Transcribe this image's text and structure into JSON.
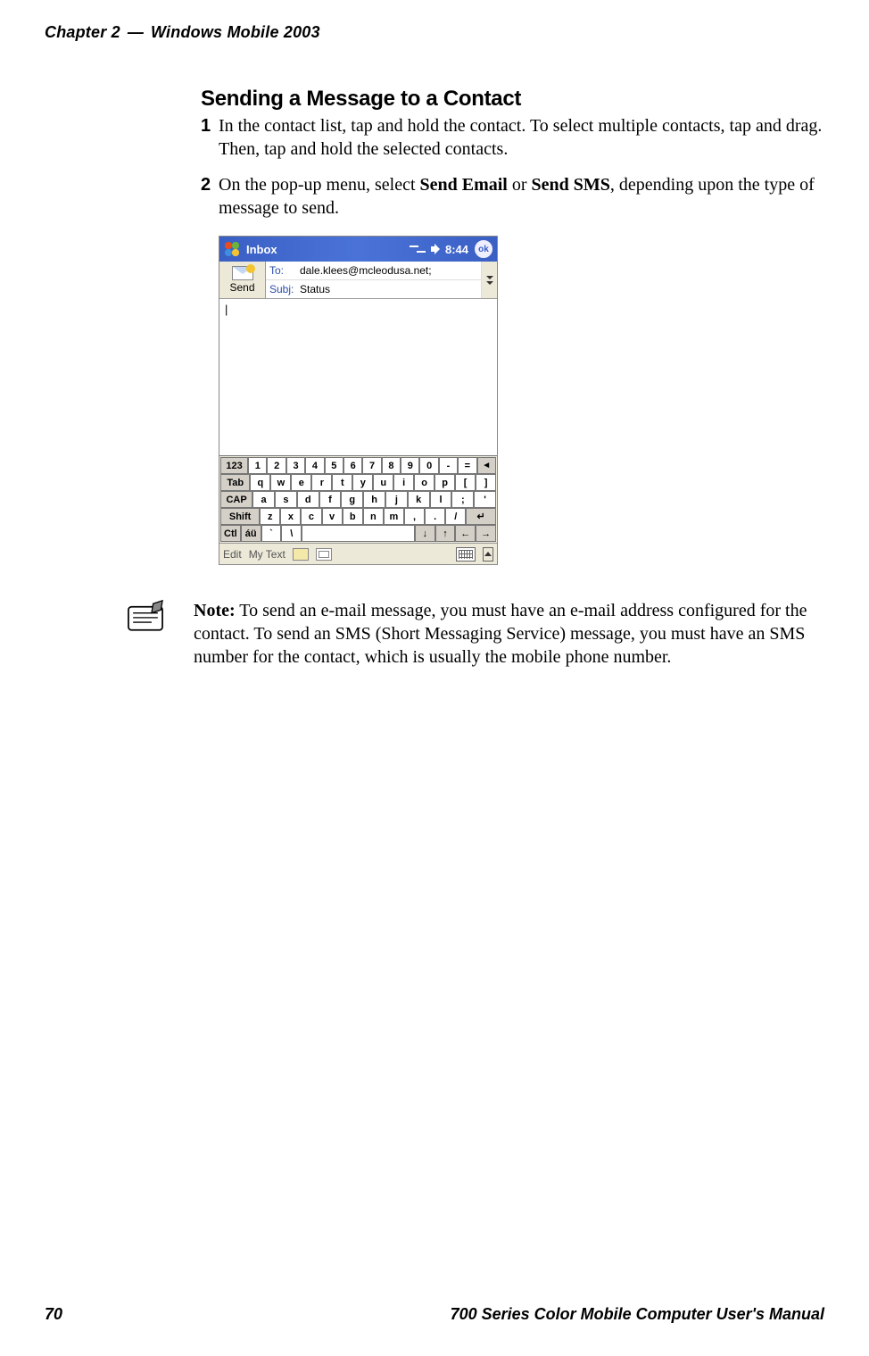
{
  "header": {
    "chapter": "Chapter 2",
    "dash": "—",
    "title": "Windows Mobile 2003"
  },
  "heading": "Sending a Message to a Contact",
  "steps": [
    {
      "num": "1",
      "text": "In the contact list, tap and hold the contact. To select multiple contacts, tap and drag. Then, tap and hold the selected contacts."
    },
    {
      "num": "2",
      "prefix": "On the pop-up menu, select ",
      "bold1": "Send Email",
      "mid": " or ",
      "bold2": "Send SMS",
      "suffix": ", depending upon the type of message to send."
    }
  ],
  "screenshot": {
    "title": "Inbox",
    "time": "8:44",
    "ok": "ok",
    "send": "Send",
    "to_label": "To:",
    "to_value": "dale.klees@mcleodusa.net;",
    "subj_label": "Subj:",
    "subj_value": "Status",
    "cursor": "|",
    "keyboard": {
      "row1": [
        "123",
        "1",
        "2",
        "3",
        "4",
        "5",
        "6",
        "7",
        "8",
        "9",
        "0",
        "-",
        "="
      ],
      "row2": [
        "Tab",
        "q",
        "w",
        "e",
        "r",
        "t",
        "y",
        "u",
        "i",
        "o",
        "p",
        "[",
        "]"
      ],
      "row3": [
        "CAP",
        "a",
        "s",
        "d",
        "f",
        "g",
        "h",
        "j",
        "k",
        "l",
        ";",
        "'"
      ],
      "row4": [
        "Shift",
        "z",
        "x",
        "c",
        "v",
        "b",
        "n",
        "m",
        ",",
        ".",
        "/"
      ],
      "row5": [
        "Ctl",
        "áü",
        "`",
        "\\",
        "↓",
        "↑",
        "←",
        "→"
      ]
    },
    "toolbar": {
      "edit": "Edit",
      "mytext": "My Text"
    }
  },
  "note": {
    "label": "Note:",
    "text": " To send an e-mail message, you must have an e-mail address configured for the contact. To send an SMS (Short Messaging Service) message, you must have an SMS number for the contact, which is usually the mobile phone number."
  },
  "footer": {
    "page": "70",
    "manual": "700 Series Color Mobile Computer User's Manual"
  }
}
